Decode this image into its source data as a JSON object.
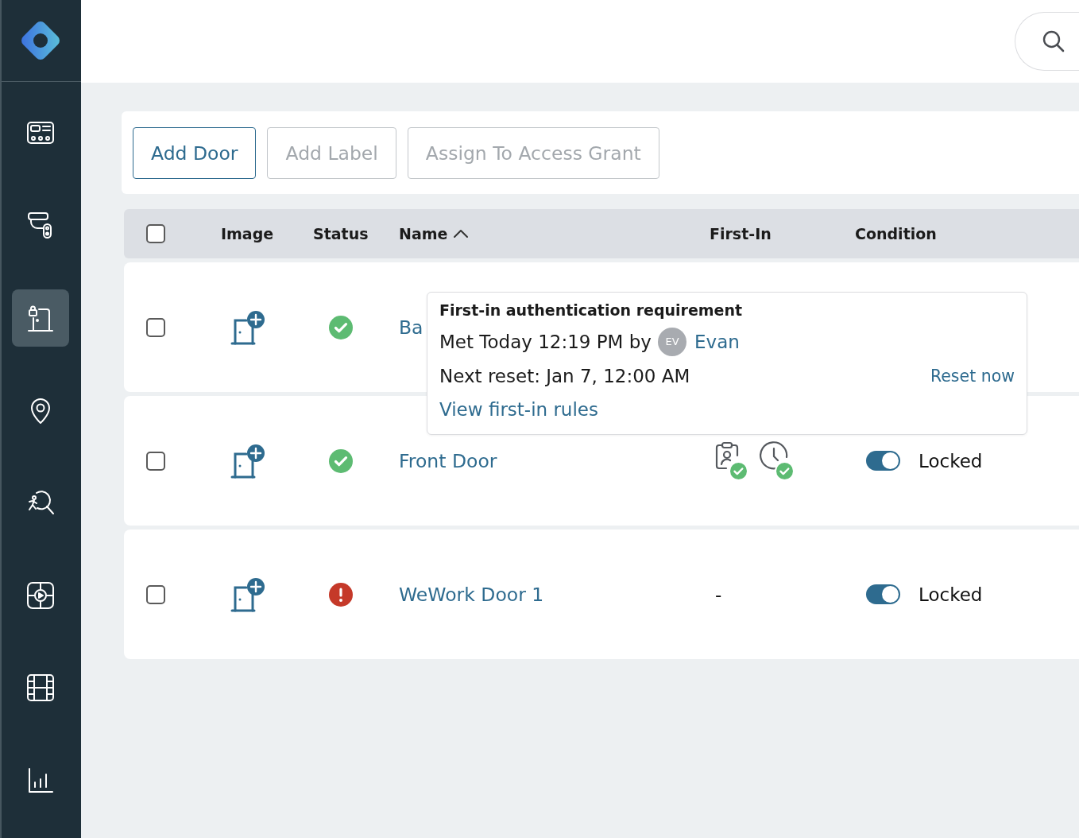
{
  "sidebar": {
    "items": [
      {
        "selected": false
      },
      {
        "selected": false
      },
      {
        "selected": true
      },
      {
        "selected": false
      },
      {
        "selected": false
      },
      {
        "selected": false
      },
      {
        "selected": false
      },
      {
        "selected": false
      }
    ]
  },
  "toolbar": {
    "buttons": [
      {
        "label": "Add Door",
        "disabled": false
      },
      {
        "label": "Add Label",
        "disabled": true
      },
      {
        "label": "Assign To Access Grant",
        "disabled": true
      }
    ]
  },
  "table": {
    "select_all": {
      "checked": false
    },
    "columns": [
      {
        "label": "Image"
      },
      {
        "label": "Status"
      },
      {
        "label": "Name",
        "sorted": true
      },
      {
        "label": "First-In"
      },
      {
        "label": "Condition"
      }
    ],
    "rows": [
      {
        "checked": false,
        "ok": true,
        "name": "Ba"
      },
      {
        "checked": false,
        "ok": true,
        "name": "Front Door",
        "first_in": {
          "kind": "checks",
          "checks": [
            {
              "kind": "credential",
              "met": true
            },
            {
              "kind": "schedule",
              "met": true
            }
          ]
        },
        "condition": {
          "on": true,
          "label": "Locked"
        }
      },
      {
        "checked": false,
        "ok": false,
        "name": "WeWork Door 1",
        "first_in": {
          "kind": "text",
          "text": "-"
        },
        "condition": {
          "on": true,
          "label": "Locked"
        }
      }
    ]
  },
  "tooltip": {
    "title": "First-in authentication requirement",
    "met_text": "Met Today 12:19 PM by",
    "avatar_initials": "EV",
    "user": "Evan",
    "next_reset": "Next reset: Jan 7, 12:00 AM",
    "reset_link": "Reset now",
    "rules_link": "View first-in rules"
  }
}
